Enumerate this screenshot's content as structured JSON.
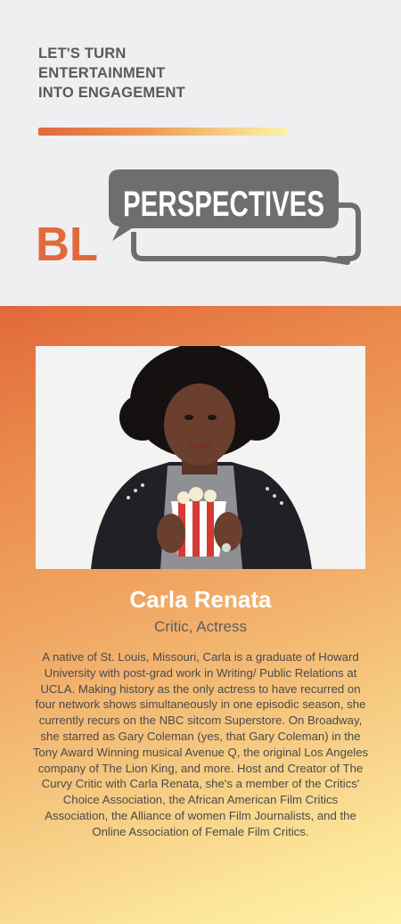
{
  "header": {
    "tagline_lines": [
      "LET'S TURN",
      "ENTERTAINMENT",
      "INTO ENGAGEMENT"
    ]
  },
  "logo": {
    "initials": "BL",
    "wordmark": "PERSPECTIVES"
  },
  "profile": {
    "name": "Carla Renata",
    "role": "Critic, Actress",
    "bio": "A native of St. Louis, Missouri, Carla is a graduate of Howard University with post-grad work in Writing/ Public Relations at UCLA. Making history as the only actress to have recurred on four network shows simultaneously in one episodic season, she currently recurs on the NBC sitcom Superstore. On Broadway, she starred as Gary Coleman (yes, that Gary Coleman) in the Tony Award Winning musical Avenue Q, the original Los Angeles company of The Lion King, and more. Host and Creator of The Curvy Critic with Carla Renata, she's a member of the Critics' Choice Association, the African American Film Critics Association, the Alliance of women Film Journalists, and the Online Association of Female Film Critics."
  },
  "colors": {
    "accent_orange": "#e06a3c",
    "bubble_gray": "#6d6e70",
    "tagline_gray": "#58595b",
    "pale_yellow": "#fff3a8"
  }
}
